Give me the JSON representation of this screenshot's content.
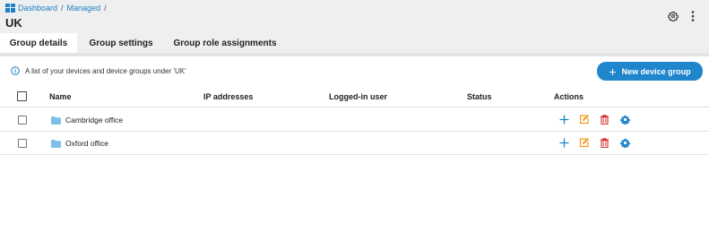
{
  "breadcrumb": {
    "items": [
      "Dashboard",
      "Managed"
    ],
    "separator": "/"
  },
  "page": {
    "title": "UK"
  },
  "header": {
    "settings_icon": "gear-icon",
    "menu_icon": "kebab-menu-icon"
  },
  "tabs": [
    {
      "label": "Group details",
      "active": true
    },
    {
      "label": "Group settings",
      "active": false
    },
    {
      "label": "Group role assignments",
      "active": false
    }
  ],
  "info": {
    "text": "A list of your devices and device groups under 'UK'"
  },
  "new_button": {
    "label": "New device group"
  },
  "table": {
    "columns": [
      "Name",
      "IP addresses",
      "Logged-in user",
      "Status",
      "Actions"
    ],
    "rows": [
      {
        "name": "Cambridge office",
        "ip": "",
        "user": "",
        "status": ""
      },
      {
        "name": "Oxford office",
        "ip": "",
        "user": "",
        "status": ""
      }
    ],
    "row_actions": [
      "add-icon",
      "edit-icon",
      "delete-icon",
      "settings-icon"
    ]
  },
  "colors": {
    "accent": "#1f86cc",
    "link": "#1d7fc4",
    "edit": "#f39a1d",
    "delete": "#d32f2f",
    "folder": "#7cc0ea"
  }
}
